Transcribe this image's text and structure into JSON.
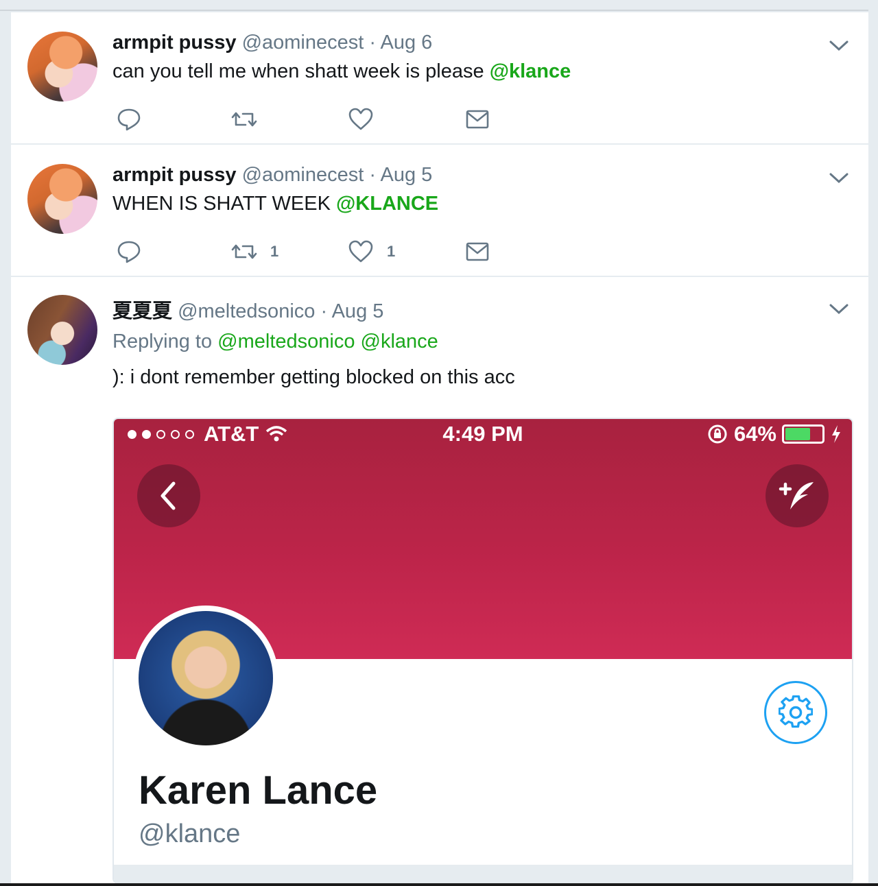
{
  "tweets": [
    {
      "name": "armpit pussy",
      "handle": "@aominecest",
      "sep": "·",
      "date": "Aug 6",
      "text": "can you tell me when shatt week is please ",
      "mention": "@klance",
      "retweets": "",
      "likes": ""
    },
    {
      "name": "armpit pussy",
      "handle": "@aominecest",
      "sep": "·",
      "date": "Aug 5",
      "text": "WHEN IS SHATT WEEK ",
      "mention": "@KLANCE",
      "retweets": "1",
      "likes": "1"
    },
    {
      "name": "夏夏夏",
      "handle": "@meltedsonico",
      "sep": "·",
      "date": "Aug 5",
      "replying_label": "Replying to",
      "replying_to_1": "@meltedsonico",
      "replying_to_2": "@klance",
      "text": "): i dont remember getting blocked on this acc"
    }
  ],
  "embedded_screenshot": {
    "carrier": "AT&T",
    "time": "4:49 PM",
    "battery": "64%",
    "battery_level": 0.64,
    "profile_name": "Karen Lance",
    "profile_handle": "@klance",
    "banner_color": "#bc2449",
    "follow_accent": "#1da1f2"
  },
  "colors": {
    "mention": "#19a71a",
    "secondary_text": "#657786",
    "primary_text": "#14171a"
  }
}
